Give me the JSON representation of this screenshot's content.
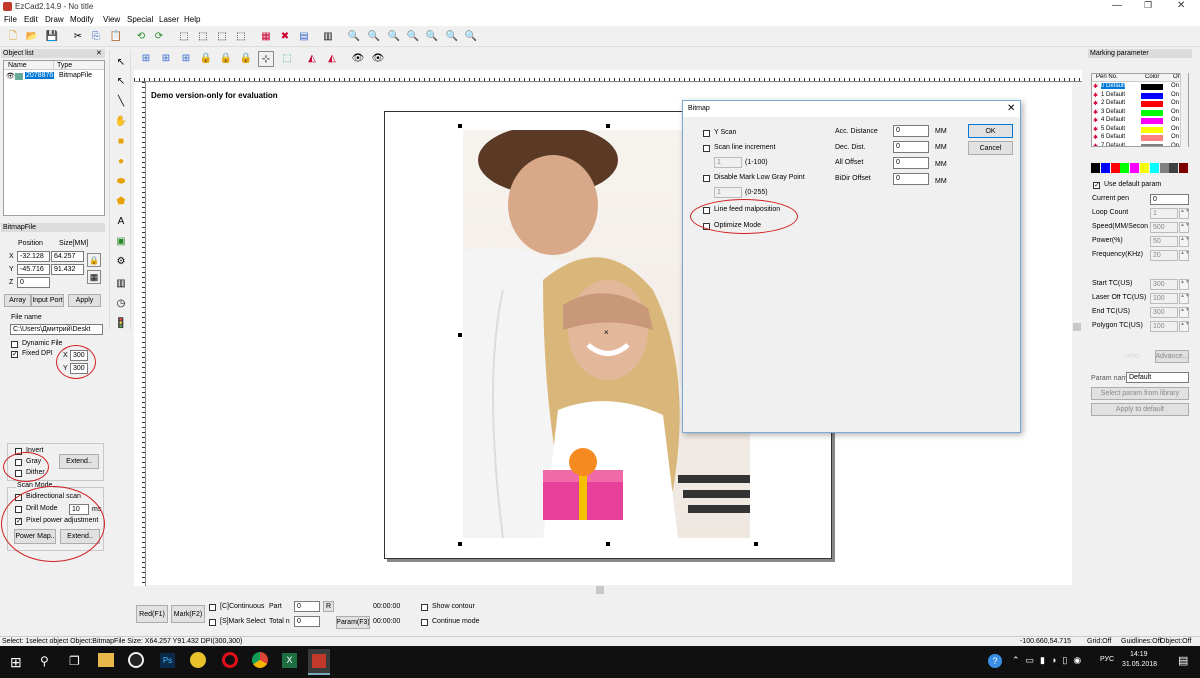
{
  "window": {
    "title": "EzCad2.14.9 - No title"
  },
  "menu": [
    "File",
    "Edit",
    "Draw",
    "Modify",
    "View",
    "Special",
    "Laser",
    "Help"
  ],
  "canvas": {
    "watermark": "Demo version-only for evaluation"
  },
  "object_list": {
    "title": "Object list",
    "col_name": "Name",
    "col_type": "Type",
    "row_name": "2078876",
    "row_type": "BitmapFile"
  },
  "bitmap_panel": {
    "title": "BitmapFile",
    "position_label": "Position",
    "size_label": "Size[MM]",
    "x_label": "X",
    "y_label": "Y",
    "z_label": "Z",
    "x_pos": "-32.128",
    "y_pos": "-45.716",
    "z_pos": "0",
    "width": "64.257",
    "height": "91.432",
    "array_btn": "Array",
    "input_port_btn": "Input Port",
    "apply_btn": "Apply",
    "file_name_label": "File name",
    "file_path": "C:\\Users\\Дмитрий\\Deskt",
    "dynamic_file": "Dynamic File",
    "fixed_dpi": "Fixed DPI",
    "dpi_x_label": "X",
    "dpi_y_label": "Y",
    "dpi_x": "300",
    "dpi_y": "300",
    "invert": "Invert",
    "gray": "Gray",
    "dither": "Dither",
    "extend_btn": "Extend..",
    "scan_mode": "Scan Mode",
    "bidirectional": "Bidirectional scan",
    "drill_mode": "Drill Mode",
    "drill_value": "10",
    "drill_unit": "ms",
    "pixel_power": "Pixel power adjustment",
    "power_map_btn": "Power Map..",
    "extend2_btn": "Extend.."
  },
  "marking": {
    "title": "Marking parameter",
    "col_pen": "Pen No.",
    "col_color": "Color",
    "col_on": "On/",
    "pens": [
      {
        "name": "0 Default",
        "color": "#000000",
        "on": "On"
      },
      {
        "name": "1 Default",
        "color": "#0000ff",
        "on": "On"
      },
      {
        "name": "2 Default",
        "color": "#ff0000",
        "on": "On"
      },
      {
        "name": "3 Default",
        "color": "#00ff00",
        "on": "On"
      },
      {
        "name": "4 Default",
        "color": "#ff00ff",
        "on": "On"
      },
      {
        "name": "5 Default",
        "color": "#ffff00",
        "on": "On"
      },
      {
        "name": "6 Default",
        "color": "#ff8080",
        "on": "On"
      },
      {
        "name": "7 Default",
        "color": "#808080",
        "on": "On"
      }
    ],
    "palette": [
      "#000000",
      "#0000ff",
      "#ff0000",
      "#00ff00",
      "#ff00ff",
      "#ffff00",
      "#00ffff",
      "#808080",
      "#404040",
      "#800000"
    ],
    "use_default": "Use default param",
    "params": [
      {
        "label": "Current pen",
        "value": "0"
      },
      {
        "label": "Loop Count",
        "value": "1"
      },
      {
        "label": "Speed(MM/Secon",
        "value": "500"
      },
      {
        "label": "Power(%)",
        "value": "50"
      },
      {
        "label": "Frequency(KHz)",
        "value": "20"
      },
      {
        "label": "Start TC(US)",
        "value": "300"
      },
      {
        "label": "Laser Off TC(US)",
        "value": "100"
      },
      {
        "label": "End TC(US)",
        "value": "300"
      },
      {
        "label": "Polygon TC(US)",
        "value": "100"
      }
    ],
    "advance_btn": "Advance...",
    "param_name_label": "Param name",
    "param_name": "Default",
    "select_lib_btn": "Select param from library",
    "apply_default_btn": "Apply to default"
  },
  "dialog": {
    "title": "Bitmap",
    "y_scan": "Y Scan",
    "scan_inc": "Scan line increment",
    "scan_inc_val": "1",
    "scan_inc_range": "(1-100)",
    "disable_low_gray": "Disable Mark Low Gray Point",
    "gray_val": "1",
    "gray_range": "(0-255)",
    "line_feed": "Line feed malposition",
    "optimize": "Optimize Mode",
    "acc_label": "Acc. Distance",
    "dec_label": "Dec. Dist.",
    "all_offset_label": "All Offset",
    "bidir_label": "BiDir Offset",
    "acc_val": "0",
    "dec_val": "0",
    "all_val": "0",
    "bidir_val": "0",
    "unit": "MM",
    "ok": "OK",
    "cancel": "Cancel"
  },
  "bottom": {
    "red_btn": "Red(F1)",
    "mark_btn": "Mark(F2)",
    "continuous": "[C]Continuous",
    "mark_select": "[S]Mark Select",
    "part_label": "Part",
    "part_val": "0",
    "total_label": "Total n",
    "total_val": "0",
    "r_btn": "R",
    "time1": "00:00:00",
    "time2": "00:00:00",
    "param_btn": "Param(F3)",
    "show_contour": "Show contour",
    "continue_mode": "Continue mode"
  },
  "status": {
    "text": "Select: 1select object Object:BitmapFile Size: X64.257 Y91.432 DPI(300,300)",
    "coords": "-100.660,54.715",
    "grid": "Grid:Off",
    "guidlines": "Guidlines:Off",
    "object": "Object:Off"
  },
  "taskbar": {
    "lang": "РУС",
    "time": "14:19",
    "date": "31.05.2018"
  }
}
